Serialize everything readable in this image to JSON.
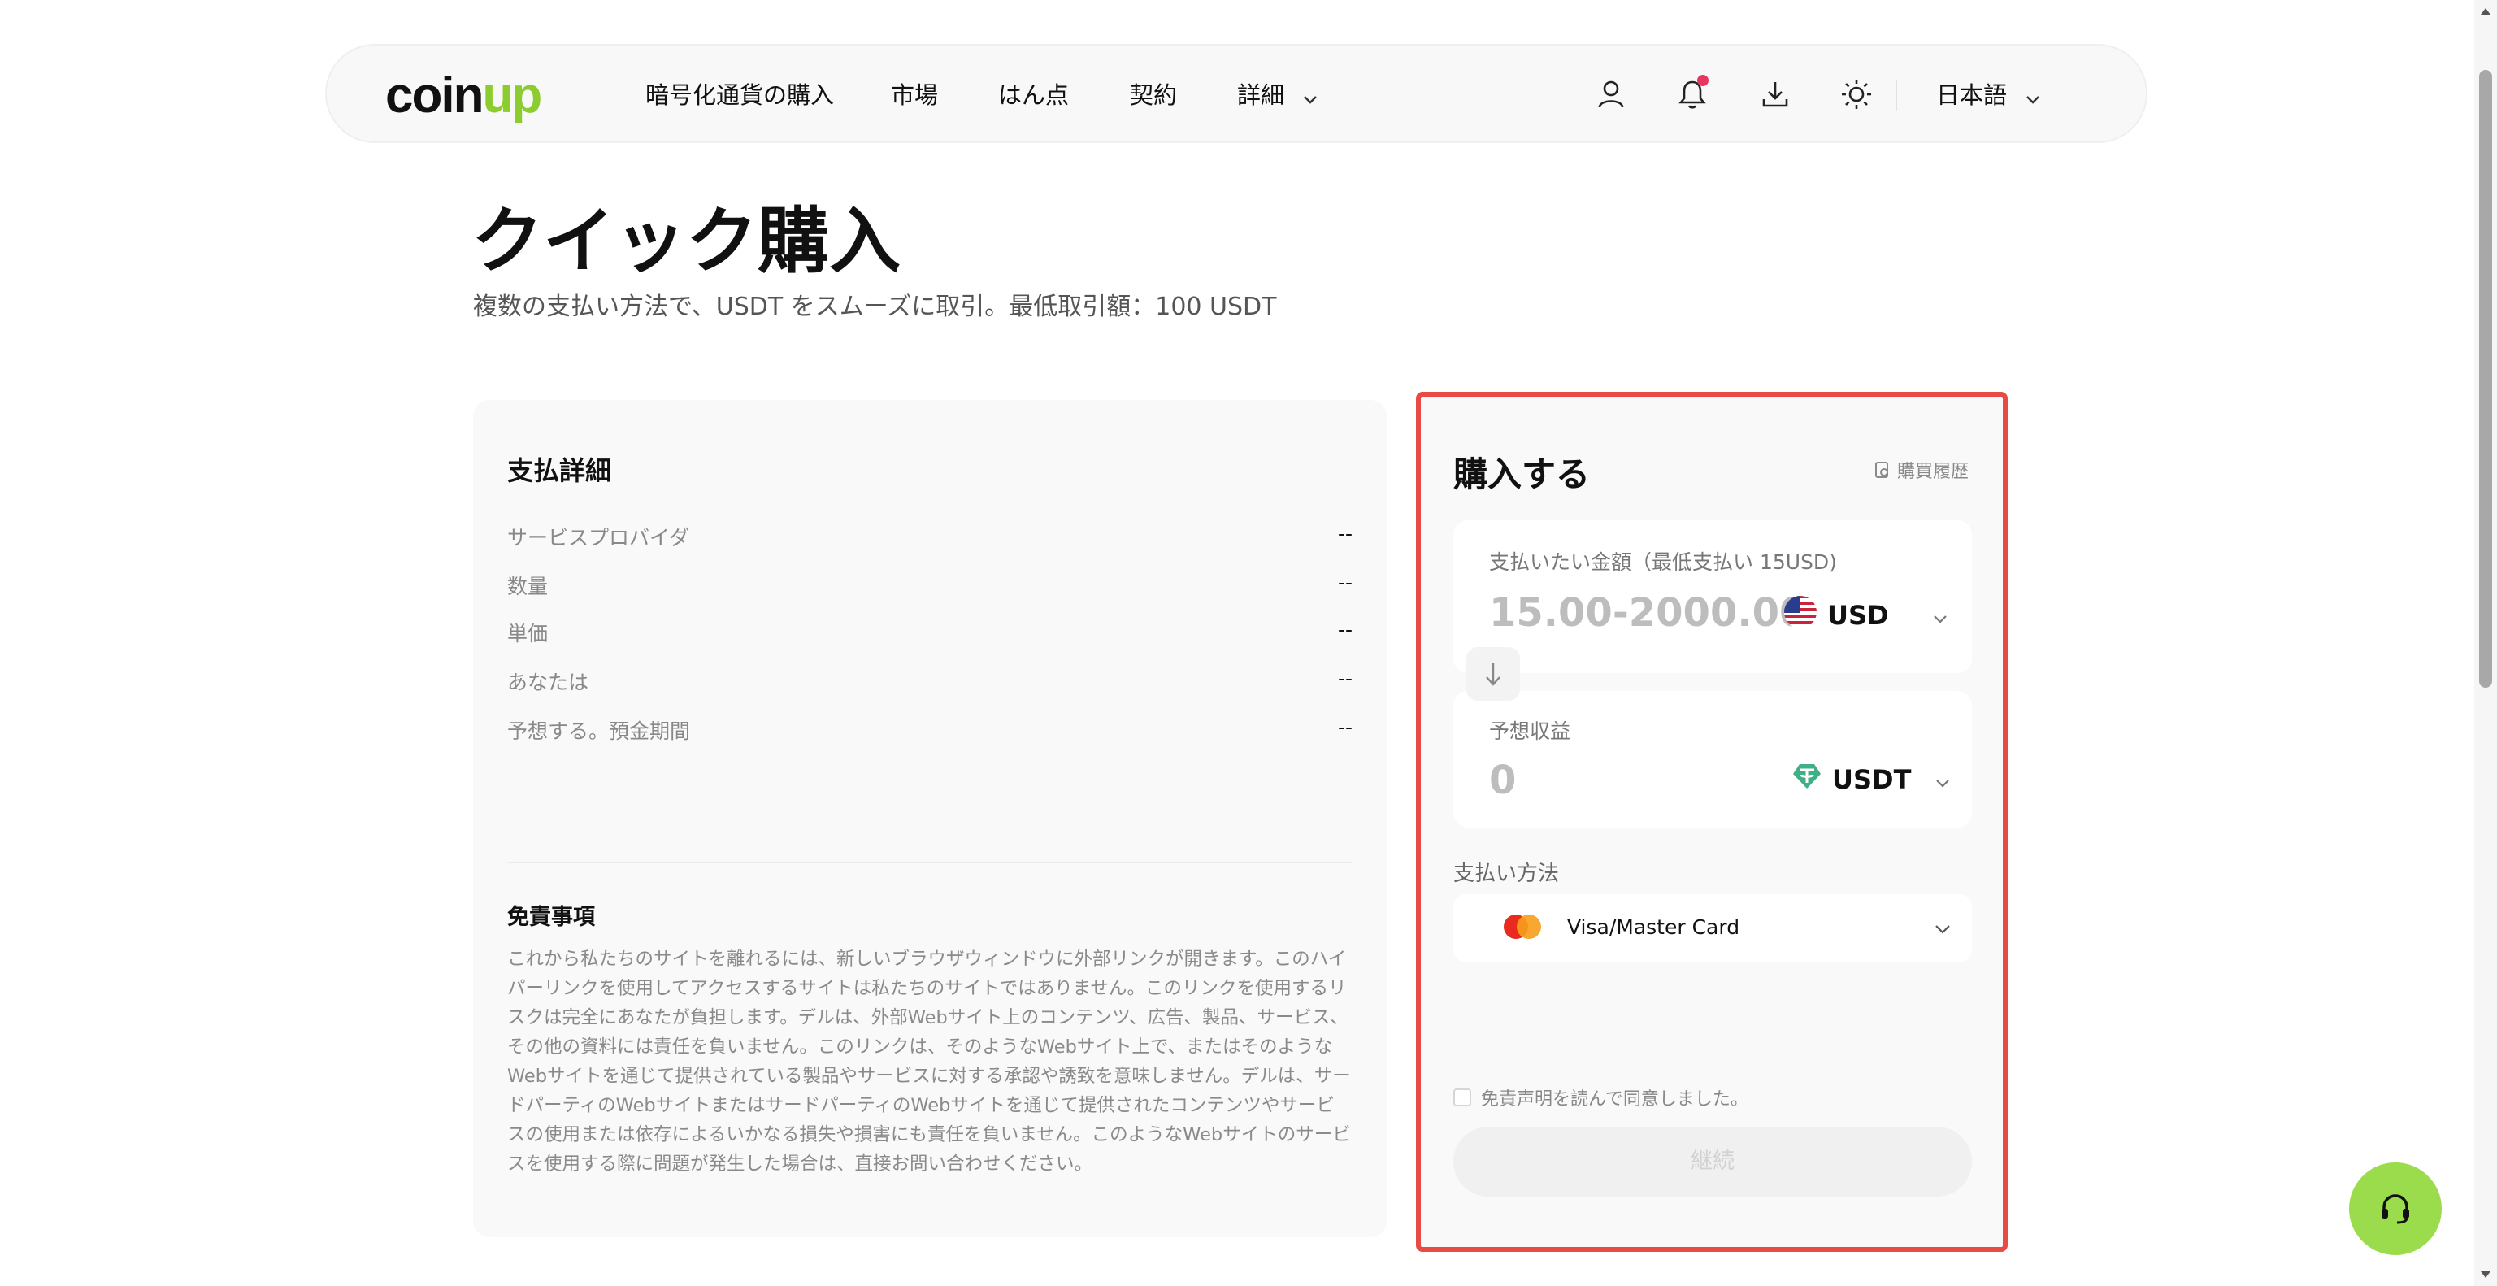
{
  "brand": {
    "logo_prefix": "coin",
    "logo_suffix": "up",
    "accent": "#8ccc2f"
  },
  "nav": {
    "items": [
      "暗号化通貨の購入",
      "市場",
      "はん点",
      "契約",
      "詳細"
    ],
    "language": "日本語",
    "icons": [
      "user-icon",
      "bell-icon",
      "download-icon",
      "sun-icon"
    ]
  },
  "header": {
    "title": "クイック購入",
    "subtitle": "複数の支払い方法で、USDT をスムーズに取引。最低取引額：100 USDT"
  },
  "payment_details": {
    "title": "支払詳細",
    "rows": [
      {
        "label": "サービスプロバイダ",
        "value": "--"
      },
      {
        "label": "数量",
        "value": "--"
      },
      {
        "label": "単価",
        "value": "--"
      },
      {
        "label": "あなたは",
        "value": "--"
      },
      {
        "label": "予想する。預金期間",
        "value": "--"
      }
    ],
    "disclaimer_title": "免責事項",
    "disclaimer_text": "これから私たちのサイトを離れるには、新しいブラウザウィンドウに外部リンクが開きます。このハイパーリンクを使用してアクセスするサイトは私たちのサイトではありません。このリンクを使用するリスクは完全にあなたが負担します。デルは、外部Webサイト上のコンテンツ、広告、製品、サービス、その他の資料には責任を負いません。このリンクは、そのようなWebサイト上で、またはそのようなWebサイトを通じて提供されている製品やサービスに対する承認や誘致を意味しません。デルは、サードパーティのWebサイトまたはサードパーティのWebサイトを通じて提供されたコンテンツやサービスの使用または依存によるいかなる損失や損害にも責任を負いません。このようなWebサイトのサービスを使用する際に問題が発生した場合は、直接お問い合わせください。"
  },
  "buy": {
    "title": "購入する",
    "history_label": "購買履歴",
    "pay_label": "支払いたい金額（最低支払い 15USD)",
    "pay_placeholder": "15.00-2000.00",
    "pay_currency": "USD",
    "receive_label": "予想収益",
    "receive_value": "0",
    "receive_currency": "USDT",
    "method_label": "支払い方法",
    "method_value": "Visa/Master Card",
    "agree_label": "免責声明を読んで同意しました。",
    "continue_label": "継続",
    "highlight_color": "#e84a44"
  }
}
